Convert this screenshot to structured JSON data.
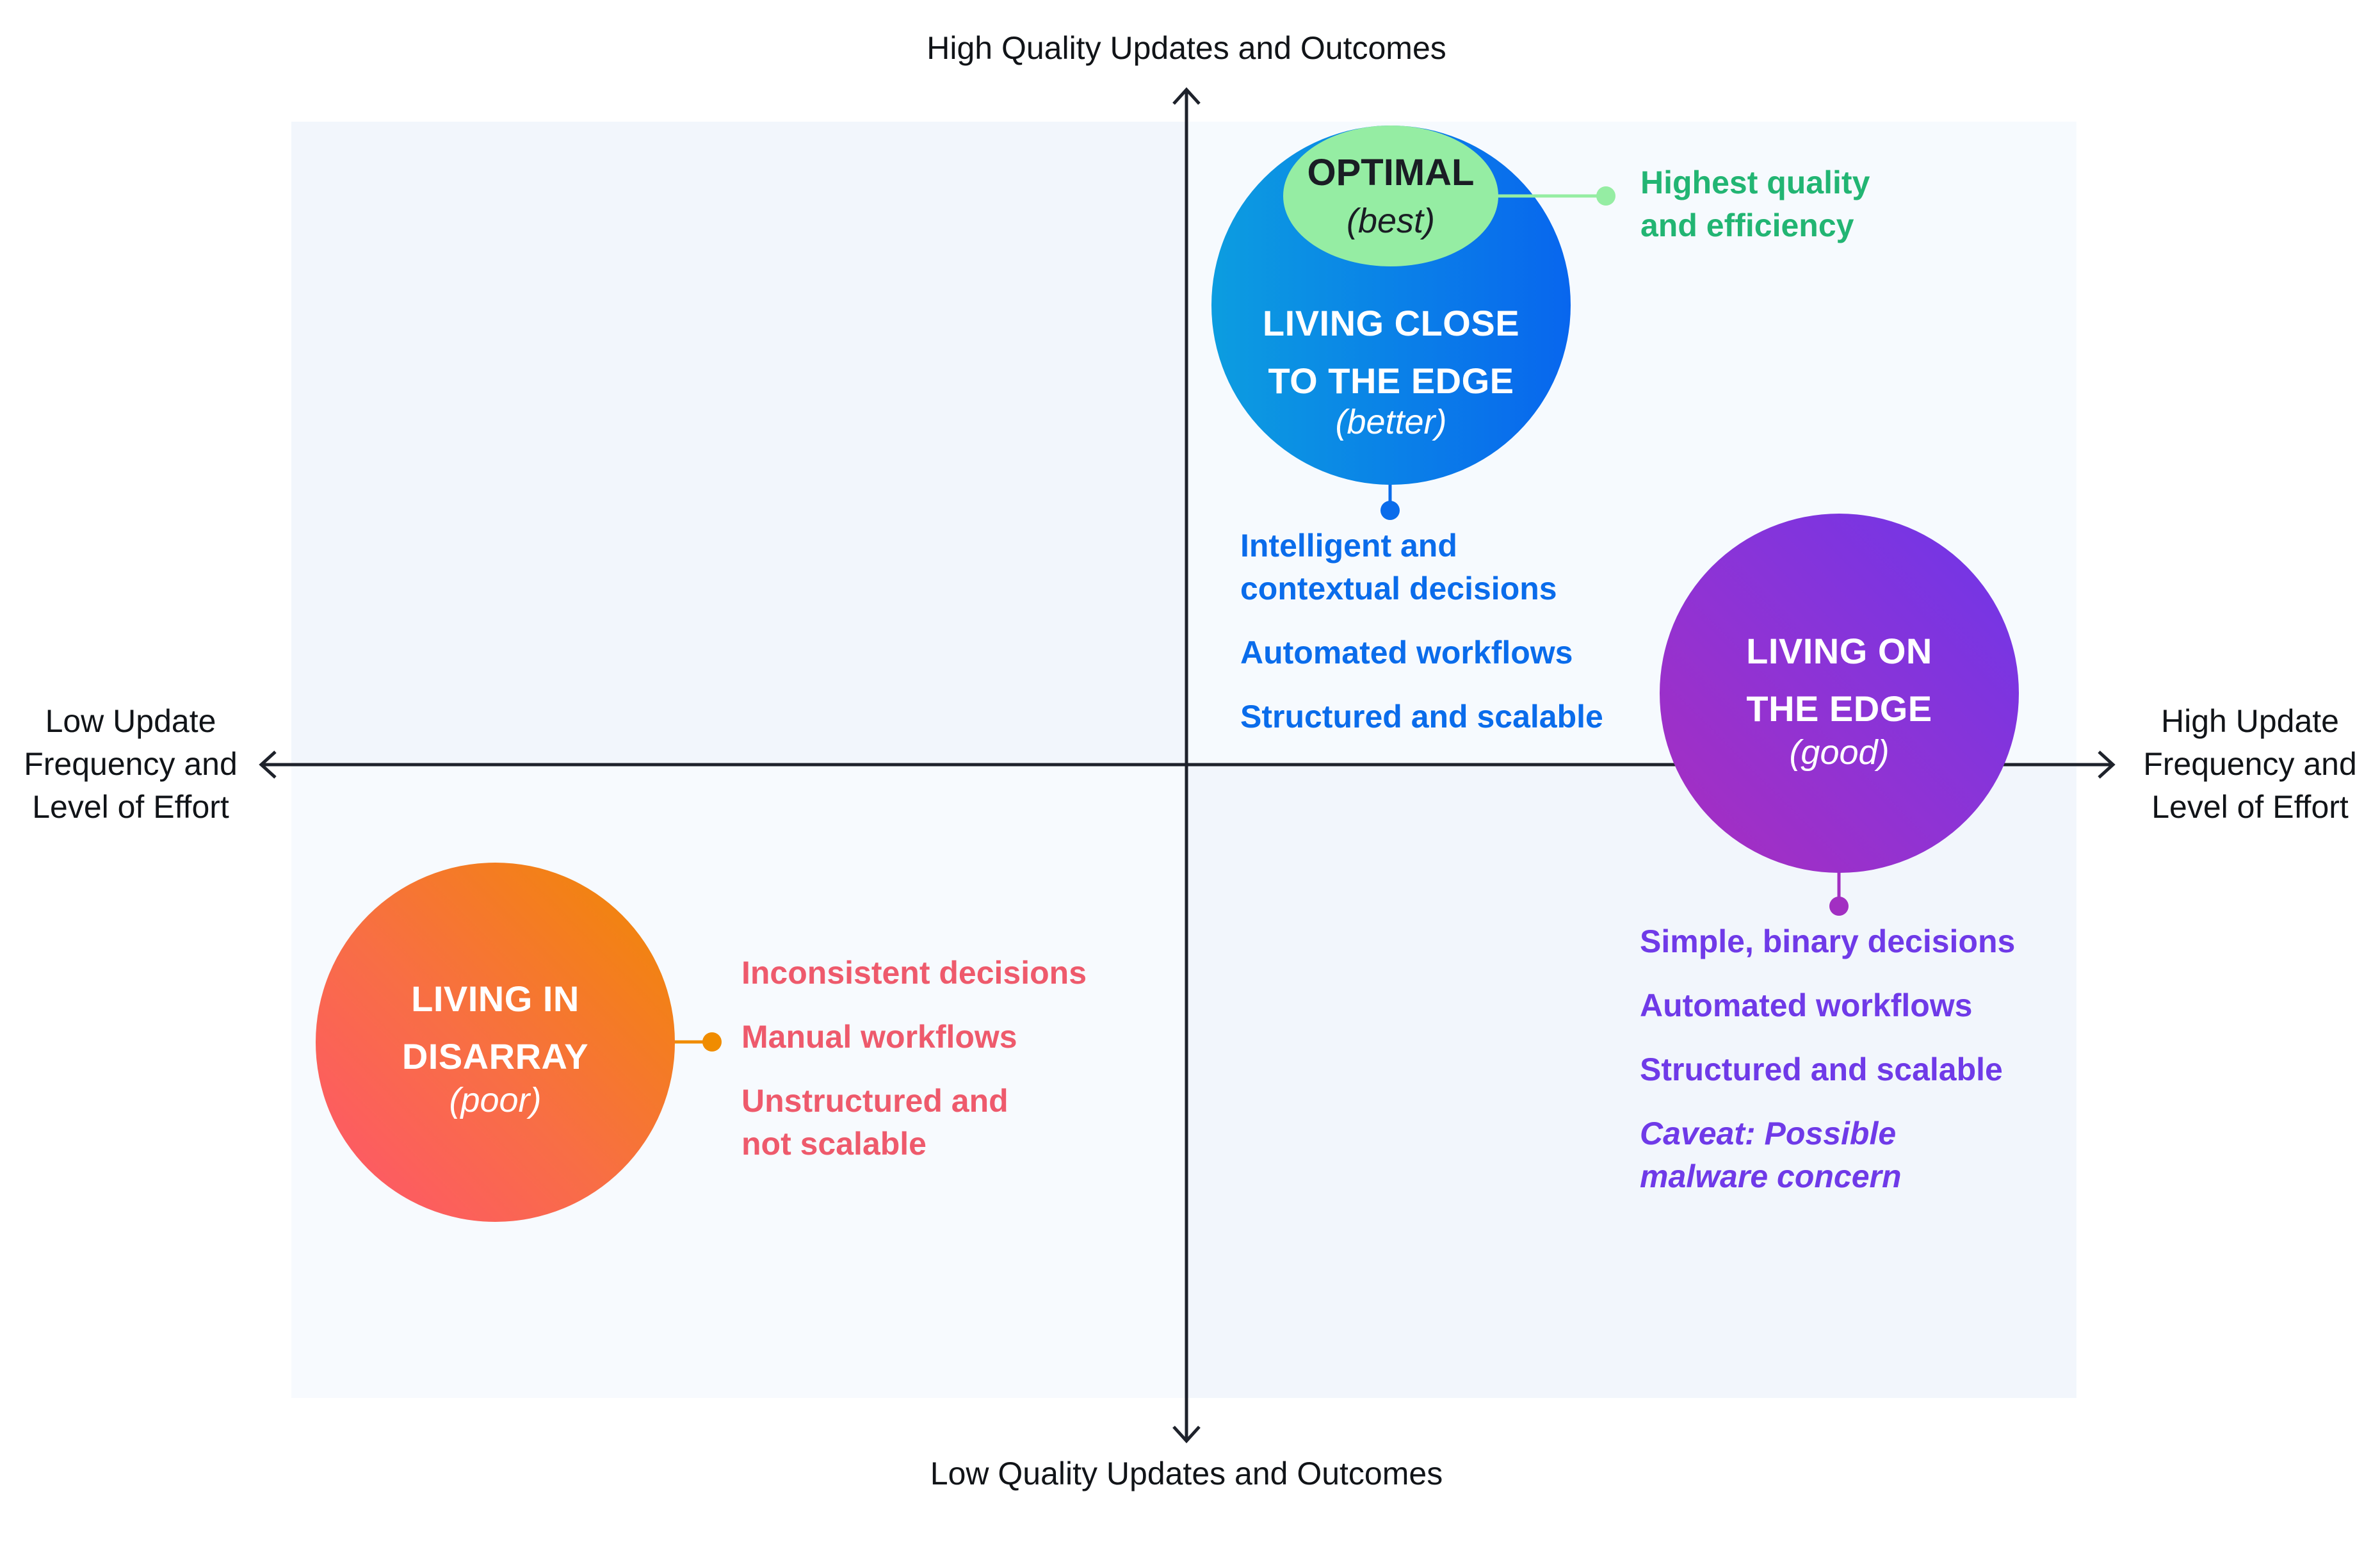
{
  "axes": {
    "top": "High Quality Updates and Outcomes",
    "bottom": "Low Quality Updates and Outcomes",
    "left": "Low Update\nFrequency and\nLevel of Effort",
    "right": "High Update\nFrequency and\nLevel of Effort"
  },
  "colors": {
    "axis": "#1E222B",
    "optimal": "#95EDA3",
    "optimal_text": "#22B573",
    "close_edge": "#0A6CEB",
    "on_edge": "#6F3AE8",
    "on_edge_stem": "#A22FC2",
    "disarray": "#EE5A6C",
    "disarray_dot": "#F08C00"
  },
  "nodes": {
    "optimal": {
      "title": "OPTIMAL",
      "rating": "(best)",
      "notes": [
        "Highest quality\nand efficiency"
      ]
    },
    "close_to_edge": {
      "title_line1": "LIVING CLOSE",
      "title_line2": "TO THE EDGE",
      "rating": "(better)",
      "notes": [
        "Intelligent and\ncontextual decisions",
        "Automated workflows",
        "Structured and scalable"
      ]
    },
    "on_edge": {
      "title_line1": "LIVING ON",
      "title_line2": "THE EDGE",
      "rating": "(good)",
      "notes": [
        "Simple, binary decisions",
        "Automated workflows",
        "Structured and scalable"
      ],
      "caveat": "Caveat: Possible\nmalware concern"
    },
    "disarray": {
      "title_line1": "LIVING IN",
      "title_line2": "DISARRAY",
      "rating": "(poor)",
      "notes": [
        "Inconsistent decisions",
        "Manual workflows",
        "Unstructured and\nnot scalable"
      ]
    }
  }
}
